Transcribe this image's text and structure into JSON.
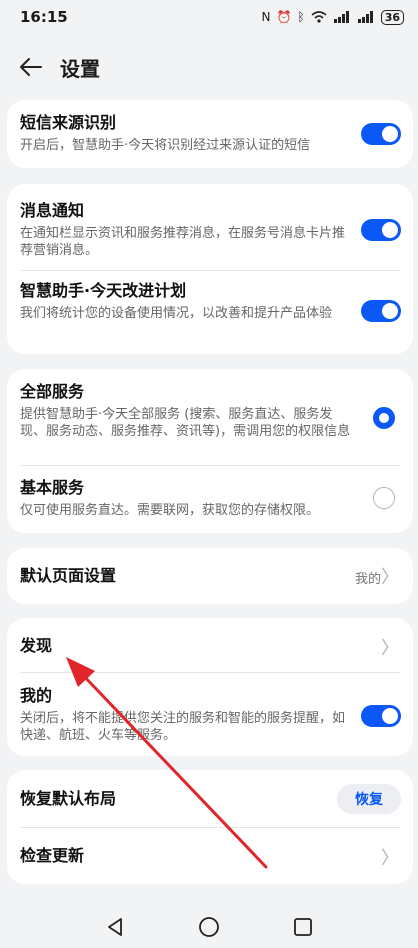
{
  "status": {
    "time": "16:15",
    "battery": "36"
  },
  "header": {
    "title": "设置"
  },
  "sms": {
    "title": "短信来源识别",
    "desc": "开启后，智慧助手·今天将识别经过来源认证的短信"
  },
  "notify": {
    "title": "消息通知",
    "desc": "在通知栏显示资讯和服务推荐消息，在服务号消息卡片推荐营销消息。"
  },
  "improve": {
    "title": "智慧助手·今天改进计划",
    "desc": "我们将统计您的设备使用情况，以改善和提升产品体验"
  },
  "full_service": {
    "title": "全部服务",
    "desc": "提供智慧助手·今天全部服务 (搜索、服务直达、服务发现、服务动态、服务推荐、资讯等)，需调用您的权限信息"
  },
  "basic_service": {
    "title": "基本服务",
    "desc": "仅可使用服务直达。需要联网，获取您的存储权限。"
  },
  "default_page": {
    "title": "默认页面设置",
    "value": "我的"
  },
  "discover": {
    "title": "发现"
  },
  "mine": {
    "title": "我的",
    "desc": "关闭后，将不能提供您关注的服务和智能的服务提醒，如快递、航班、火车等服务。"
  },
  "restore": {
    "title": "恢复默认布局",
    "button": "恢复"
  },
  "update": {
    "title": "检查更新"
  },
  "colors": {
    "accent": "#0a59f7",
    "annotation_arrow": "#e0252b"
  },
  "icons": [
    "back-arrow-icon",
    "nfc-icon",
    "alarm-icon",
    "bluetooth-icon",
    "wifi-icon",
    "signal-icon",
    "battery-icon",
    "chevron-right-icon",
    "nav-back-icon",
    "nav-home-icon",
    "nav-recent-icon"
  ]
}
